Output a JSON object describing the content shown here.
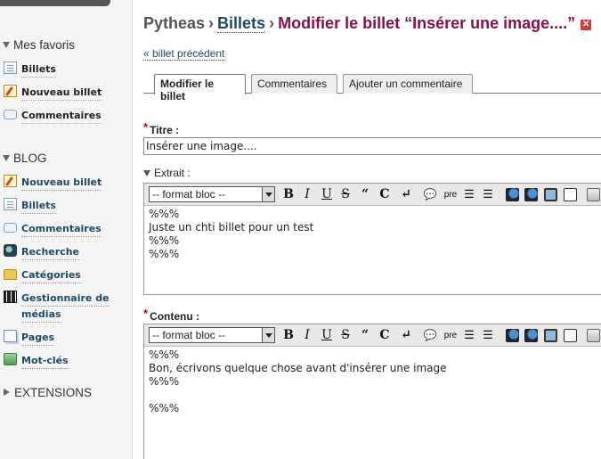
{
  "sidebar": {
    "favorites": {
      "title": "Mes favoris",
      "items": [
        {
          "label": "Billets",
          "icon": "document-icon"
        },
        {
          "label": "Nouveau billet",
          "icon": "edit-icon"
        },
        {
          "label": "Commentaires",
          "icon": "comment-icon"
        }
      ]
    },
    "blog": {
      "title": "BLOG",
      "items": [
        {
          "label": "Nouveau billet",
          "icon": "edit-icon"
        },
        {
          "label": "Billets",
          "icon": "document-icon"
        },
        {
          "label": "Commentaires",
          "icon": "comment-icon"
        },
        {
          "label": "Recherche",
          "icon": "search-icon"
        },
        {
          "label": "Catégories",
          "icon": "folder-icon"
        },
        {
          "label": "Gestionnaire de médias",
          "line1": "Gestionnaire de",
          "line2": "médias",
          "icon": "film-icon"
        },
        {
          "label": "Pages",
          "icon": "pages-icon"
        },
        {
          "label": "Mot-clés",
          "icon": "tag-icon"
        }
      ]
    },
    "extensions": {
      "title": "EXTENSIONS"
    }
  },
  "breadcrumb": {
    "site": "Pytheas",
    "separator": "›",
    "section": "Billets",
    "current": "Modifier le billet “Insérer une image....”"
  },
  "prev_link": "« billet précédent",
  "tabs": [
    "Modifier le billet",
    "Commentaires",
    "Ajouter un commentaire"
  ],
  "form": {
    "required_mark": "*",
    "title_label": "Titre :",
    "title_value": "Insérer une image....",
    "excerpt_label": "Extrait :",
    "excerpt_text": "%%%\nJuste un chti billet pour un test\n%%%\n%%%",
    "content_label": "Contenu :",
    "content_text": "%%%\nBon, écrivons quelque chose avant d'insérer une image\n%%%\n\n%%%"
  },
  "toolbar": {
    "format_select": "-- format bloc --",
    "bold": "B",
    "italic": "I",
    "underline": "U",
    "strike": "S",
    "quote": "“",
    "code": "C",
    "break": "↵",
    "pre": "pre"
  }
}
